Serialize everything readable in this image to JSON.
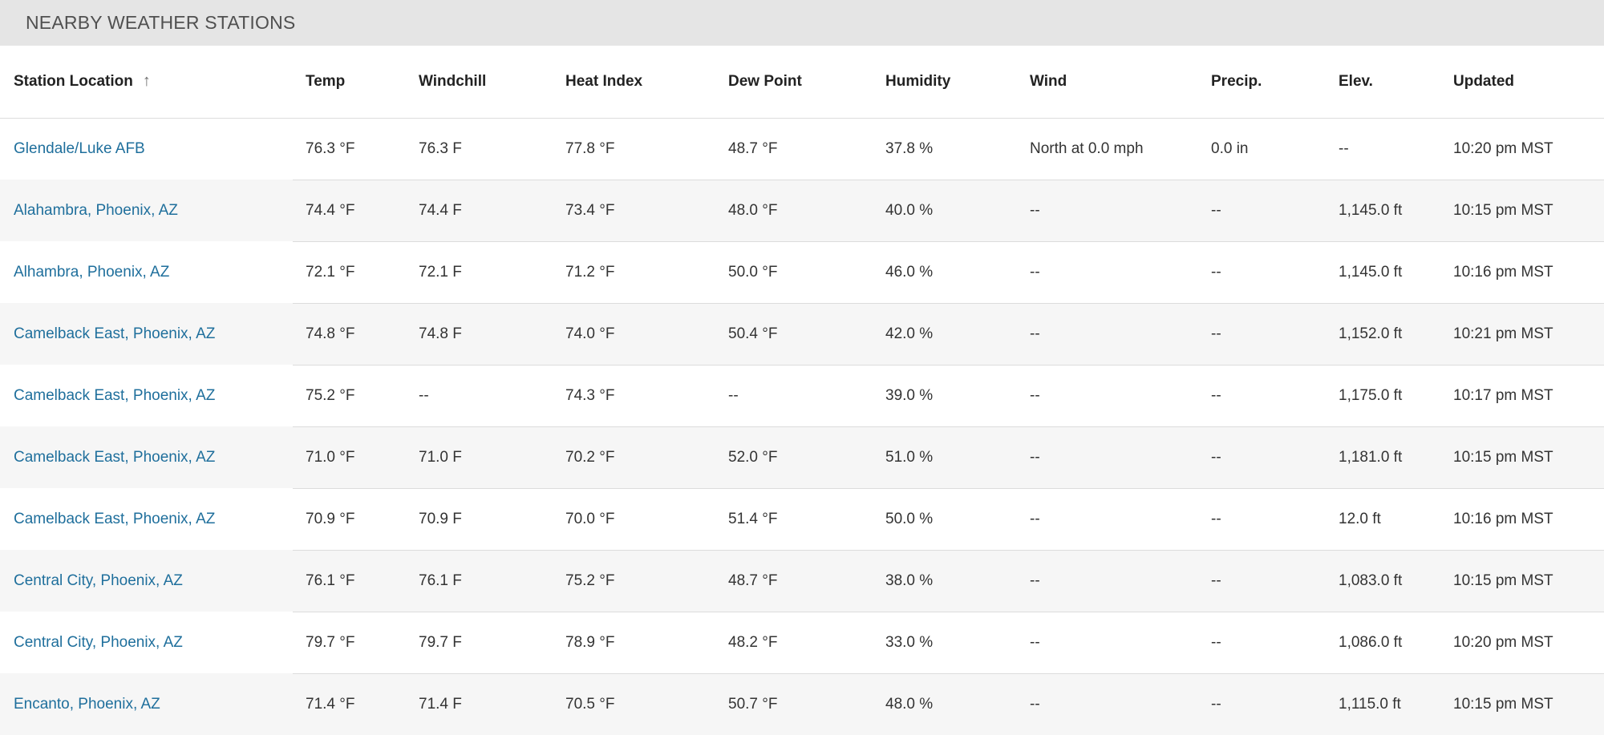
{
  "panel": {
    "title": "NEARBY WEATHER STATIONS"
  },
  "table": {
    "sort_icon": "arrow-up-icon",
    "columns": [
      {
        "key": "station",
        "label": "Station Location"
      },
      {
        "key": "temp",
        "label": "Temp"
      },
      {
        "key": "windchill",
        "label": "Windchill"
      },
      {
        "key": "heat_index",
        "label": "Heat Index"
      },
      {
        "key": "dew_point",
        "label": "Dew Point"
      },
      {
        "key": "humidity",
        "label": "Humidity"
      },
      {
        "key": "wind",
        "label": "Wind"
      },
      {
        "key": "precip",
        "label": "Precip."
      },
      {
        "key": "elev",
        "label": "Elev."
      },
      {
        "key": "updated",
        "label": "Updated"
      }
    ],
    "rows": [
      {
        "station": "Glendale/Luke AFB",
        "temp": "76.3 °F",
        "windchill": "76.3 F",
        "heat_index": "77.8 °F",
        "dew_point": "48.7 °F",
        "humidity": "37.8 %",
        "wind": "North at 0.0 mph",
        "precip": "0.0 in",
        "elev": "--",
        "updated": "10:20 pm MST"
      },
      {
        "station": "Alahambra, Phoenix, AZ",
        "temp": "74.4 °F",
        "windchill": "74.4 F",
        "heat_index": "73.4 °F",
        "dew_point": "48.0 °F",
        "humidity": "40.0 %",
        "wind": "--",
        "precip": "--",
        "elev": "1,145.0 ft",
        "updated": "10:15 pm MST"
      },
      {
        "station": "Alhambra, Phoenix, AZ",
        "temp": "72.1 °F",
        "windchill": "72.1 F",
        "heat_index": "71.2 °F",
        "dew_point": "50.0 °F",
        "humidity": "46.0 %",
        "wind": "--",
        "precip": "--",
        "elev": "1,145.0 ft",
        "updated": "10:16 pm MST"
      },
      {
        "station": "Camelback East, Phoenix, AZ",
        "temp": "74.8 °F",
        "windchill": "74.8 F",
        "heat_index": "74.0 °F",
        "dew_point": "50.4 °F",
        "humidity": "42.0 %",
        "wind": "--",
        "precip": "--",
        "elev": "1,152.0 ft",
        "updated": "10:21 pm MST"
      },
      {
        "station": "Camelback East, Phoenix, AZ",
        "temp": "75.2 °F",
        "windchill": "--",
        "heat_index": "74.3 °F",
        "dew_point": "--",
        "humidity": "39.0 %",
        "wind": "--",
        "precip": "--",
        "elev": "1,175.0 ft",
        "updated": "10:17 pm MST"
      },
      {
        "station": "Camelback East, Phoenix, AZ",
        "temp": "71.0 °F",
        "windchill": "71.0 F",
        "heat_index": "70.2 °F",
        "dew_point": "52.0 °F",
        "humidity": "51.0 %",
        "wind": "--",
        "precip": "--",
        "elev": "1,181.0 ft",
        "updated": "10:15 pm MST"
      },
      {
        "station": "Camelback East, Phoenix, AZ",
        "temp": "70.9 °F",
        "windchill": "70.9 F",
        "heat_index": "70.0 °F",
        "dew_point": "51.4 °F",
        "humidity": "50.0 %",
        "wind": "--",
        "precip": "--",
        "elev": "12.0 ft",
        "updated": "10:16 pm MST"
      },
      {
        "station": "Central City, Phoenix, AZ",
        "temp": "76.1 °F",
        "windchill": "76.1 F",
        "heat_index": "75.2 °F",
        "dew_point": "48.7 °F",
        "humidity": "38.0 %",
        "wind": "--",
        "precip": "--",
        "elev": "1,083.0 ft",
        "updated": "10:15 pm MST"
      },
      {
        "station": "Central City, Phoenix, AZ",
        "temp": "79.7 °F",
        "windchill": "79.7 F",
        "heat_index": "78.9 °F",
        "dew_point": "48.2 °F",
        "humidity": "33.0 %",
        "wind": "--",
        "precip": "--",
        "elev": "1,086.0 ft",
        "updated": "10:20 pm MST"
      },
      {
        "station": "Encanto, Phoenix, AZ",
        "temp": "71.4 °F",
        "windchill": "71.4 F",
        "heat_index": "70.5 °F",
        "dew_point": "50.7 °F",
        "humidity": "48.0 %",
        "wind": "--",
        "precip": "--",
        "elev": "1,115.0 ft",
        "updated": "10:15 pm MST"
      }
    ]
  }
}
